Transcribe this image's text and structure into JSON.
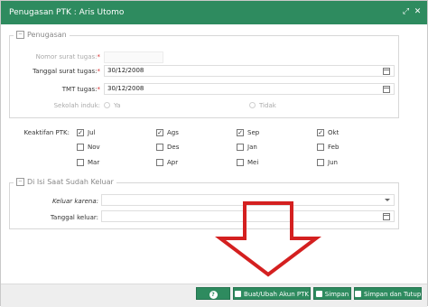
{
  "window": {
    "title": "Penugasan PTK : Aris Utomo"
  },
  "penugasan": {
    "legend": "Penugasan",
    "nomor_label": "Nomor surat tugas:",
    "nomor_value": "",
    "tanggal_label": "Tanggal surat tugas:",
    "tanggal_value": "30/12/2008",
    "tmt_label": "TMT tugas:",
    "tmt_value": "30/12/2008",
    "sekolah_label": "Sekolah induk:",
    "sekolah_options": [
      "Ya",
      "Tidak"
    ]
  },
  "keaktifan": {
    "label": "Keaktifan PTK:",
    "months": [
      {
        "name": "Jul",
        "checked": true
      },
      {
        "name": "Ags",
        "checked": true
      },
      {
        "name": "Sep",
        "checked": true
      },
      {
        "name": "Okt",
        "checked": true
      },
      {
        "name": "Nov",
        "checked": false
      },
      {
        "name": "Des",
        "checked": false
      },
      {
        "name": "Jan",
        "checked": false
      },
      {
        "name": "Feb",
        "checked": false
      },
      {
        "name": "Mar",
        "checked": false
      },
      {
        "name": "Apr",
        "checked": false
      },
      {
        "name": "Mei",
        "checked": false
      },
      {
        "name": "Jun",
        "checked": false
      }
    ]
  },
  "keluar": {
    "legend": "Di Isi Saat Sudah Keluar",
    "karena_label": "Keluar karena:",
    "karena_value": "",
    "tanggal_label": "Tanggal keluar:",
    "tanggal_value": ""
  },
  "footer": {
    "help_label": "?",
    "akun_label": "Buat/Ubah Akun PTK",
    "simpan_label": "Simpan",
    "simpan_tutup_label": "Simpan dan Tutup"
  },
  "colors": {
    "accent": "#2e8b5f",
    "arrow": "#d42020"
  }
}
